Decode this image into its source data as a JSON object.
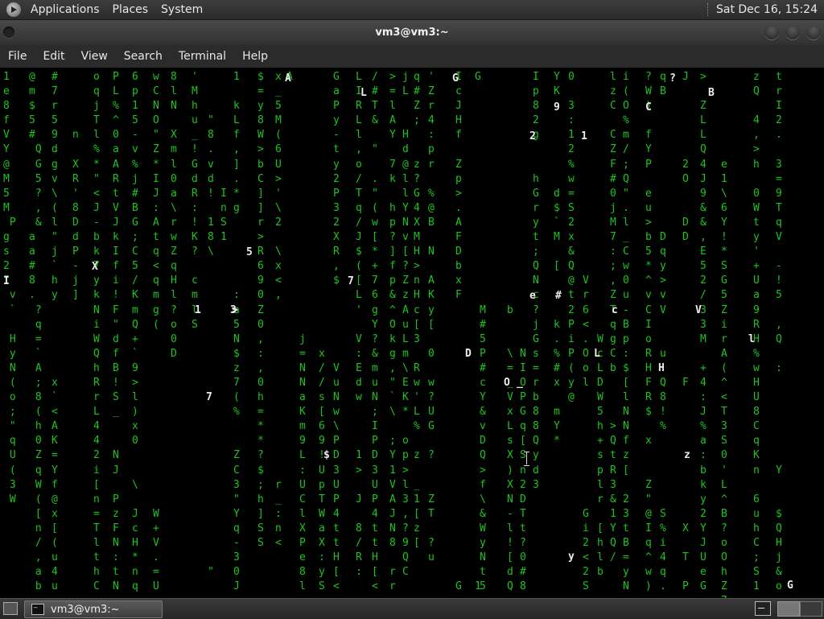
{
  "top_panel": {
    "menus": [
      "Applications",
      "Places",
      "System"
    ],
    "clock": "Sat Dec 16, 15:24"
  },
  "window": {
    "title": "vm3@vm3:~"
  },
  "menu_bar": {
    "items": [
      "File",
      "Edit",
      "View",
      "Search",
      "Terminal",
      "Help"
    ]
  },
  "terminal": {
    "rain_color": "#1ec41e",
    "highlight_color": "#ececec",
    "columns": [
      "1\ne\n8\nf\nV\nY\n@\nM\n5\nM\n P\ng\ns\n2\nI\n v\n `\n\n H\n y\n N\n (\n o\n ;\n \"\n q\n U\n (\n 3\n W",
      "@\nm\n$\n5\n#\n Q\n G\n 5\n ?\n ,\n &\na\na\n#\n8\n.\n ?\n q\n =\n `\n A\n ;\n 8\n (\n h\n 0\n Z\n q\n W\n (\n [\n n\n /\n ,\n a\n b",
      "#\n7\nr\n5\n9\nd\ng\nv\n\\\n(\nl\n\"\nj\n`\nh\ny\n\n\n\n\n\nx\n`\n<\nA\nK\n=\nY\nf\n@\nx\n[\n(\nu\n4\nu",
      "\n\n\n\nn\n\nX\nR\n'\n8\nD\nd\nP\n-\nj\n]\n",
      "o\nq\nj\nT\nl\n%\n*\n\"\n<\nJ\n-\nb\nk\n7\ny\nk\nN\ni\nW\nQ\nh\nR\nr\nL\n4\n4\n2\ni\n[\nn\n=\nT\nl\nt\nh\nC",
      "P\nL\n%\n^\n0\na\nA\nR\nt\nV\nJ\nk\nI\nf\ni\n!\nF\n\"\nd\nf\nB\n!\nS\n_\n \n \nN\nJ\n \nP\nz\nF\nN\n:\nt\nN",
      "6\np\n1\n5\n-\nv\n%\nj\n#\nB\nG\n;\nC\n5\n/\nK\nm\nQ\n+\n`\n9\n>\nl\n)\nx\n0\n \n \n\\\n \nJ\nc\nH\n*\nn\nq",
      "w\nC\nN\nO\n\"\nZ\n*\nI\nJ\n:\nA\nt\nq\n<\nq\nm\ng\n(\n\n\n\n\n\n\n\n\n\n\n\n\nW\n+\nV\n.\n=\nU",
      "8\nl\nN\n \nX\nm\nl\n0\na\n\\\nr\nw\nZ\nq\nH\nl\n?\no\n0\nD",
      "'\nM\nh\nu\n_\n!\nG\nd\nR\n:\n!\nK\n?\n \nc\nm\nl\nS",
      "\n\n\n\"\n8\n.\nv\nd\n!\n\n1\n8\n\\\n\n\n\n\n\n\n\n\n\n\n\n\n\n\n\n\n\n\n\n\n\n\"",
      "\n\n\n\n\n\n\n\nI\nn\nS\n1",
      "1\n \nk\nL\nf\n,\n]\n.\n*\ng\n \n \n \n \n \n:\na\n5\nN\n$\nz\n7\n(\n%\n \n \nZ\nC\n3\n\"\nY\nq\n-\n3\n0\nJ",
      "$\n=\ny\n8\nW\n>\nb\nC\n]\n]\nr\n>\nR\n6\n9\n0\nZ\n0\n,\n:\n,\n0\nh\n=\n*\n*\n?\n$\n;\nh\n]\nS\nS",
      "x\n_\n5\nM\n(\n6\nU\n>\n'\n\\\n2\n \n\\\nx\n<\n,\n\n\n\n\n\n\n\n\n\n\n\n\nr\n_\n:\nn\n<",
      "A",
      "\n\n\n\n\n\n\n\n\n\n\n\n\n\n\n\n\n\nj\n=\nN\nN\na\nK\nm\n9\nL\n:\nU\nC\nl\nX\nP\ne\n8\nl",
      "\n\n\n\n\n\n\n\n\n\n\n\n\n\n\n\n\n\n\nx\n/\n/\ns\n[\n6\n9\n!\nU\np\nT\nW\na\nX\n:\ny\nS",
      "G\na\nP\ny\n-\nt\ny\n2\nP\n3\n2\nX\nR\n,\n$\n\n\n\n\n\nV\nu\nN\nw\n\\\nP\nD\n3\nU\nP\n4\nt\nt\nH\n[\n<",
      "L\nI\nR\nL\nl\n,\no\n/\nT\nq\n/\nJ\n$\n(\n[\nL\n'\n\nV\n:\nE\nd\nw\n \n \n \n1\n>\n \nJ\n \n8\n/\nR\n:",
      "/\n#\nT\n&\n \n\"\n \n.\n\"\n(\nw\n[\n*\n+\n7\n6\ng\nY\n?\n&\nm\nu\nN\n;\nI\nP\nD\n3\nU\nP\n4\nt\nt\nH\n[\n<",
      ">\n=\nl\nA\nY\n \n7\nk\n \nh\np\n?\n]\nf\np\n&\n^\nO\nk\ng\n,\n\"\n`\n\\\n \n;\nY\n1\nV\nA\nJ\nN\n8\n \nr\nr",
      "j\nL\n \n \nH\nd\n@\nl\nl\nY\nN\nv\n[\n?\nZ\nz\nA\nu\nL\nm\n\\\nE\nK\n*\n \no\np\n>\nl\n3\n,\n?\n9\nQ\nC",
      "q\n#\nZ\n;\n \n \nz\n?\nG\n4\nX\nM\nH\n>\nn\nH\nc\n[\n3\n \nR\nw\n'\nL\n%\n \nz\n \n_\n1\n[\nz\n[",
      "'\nZ\nr\n4\n:\np\nr\n \n%\n@\nB\n \nN\n \nA\nK\ny\n[\n \n0\n \nw\n?\nU\nG\n \n?\n \n \nZ\nT\n \n?\nu",
      "I\nc\nJ\nH\nf\n \nZ\np\n>\n.\nA\nF\nD\nb\nx\nF\n \n\n\n\n\n\n\n\n\n\n\n\n\n\n\n\n\n\n\nG",
      "G\n\n\n\n\n\n\n\n\n\n\n\n\n\n\n\n\n\n\n\n\n\n\n\n\n\n\n\n\n\n\n\n\n\n\n1",
      "\n\n\n\n\n\n\n\n\n\n\n\n\n\n\n\nM\n#\n5\nP\n#\nc\nY\n&\nv\nD\nQ\n>\nf\n\\\n&\nW\ny\nN\nt\n5",
      "\n\n\n\n\n\n\n\n\n\n\n\n\n\n\n\nb\n \n \n\\\n=\n_\nV\nx\nL\ns\nX\n)\nX\nN\n-\nl\n!\n[\nd\nQ",
      "\n\n\n\n\n\n\n\n\n\n\n\n\n\n\n\n\n\n\nN\nI\nO\nP\nG\nq\n[\nS\nn\n2\nD\nT\nt\n?\n0\n#\n8",
      "I\np\n8\n2\ng\n \n \nh\nG\nr\ny\nt\n;\nQ\nN\nc\n?\nj\nG\ns\n=\nr\nb\n8\n8\nQ\ny\nd\n3",
      "Y\nK\n \n \n \n \n \n \nd\n$\n`\nM\n \n[\n \n \n \nk\n.\n%\n#\nx\n \nm\nY\n*",
      "0\n \n3\n:\n1\n2\n%\nw\n=\nS\n2\nx\n&\nQ\n@\nt\n2\nP\ni\nP\n(\ny\n@",
      "\n\n\n\n\n\n\n\n\n\n\n\n\n\nV\nr\n6\n<\n.\nO\no\nl\n\n\n\n\n\n\n\n\nG\ni\n2\n<\n2\nS",
      "\n\n\n\n\n\n\n\n\n\n\n\n\n\n\n\n\n\nW\nc\nL\nD\nW\n5\nh\n+\ns\np\nl\nr\n \n[\nh\nl\nb",
      "l\nz\nC\n \nC\nZ\nF\n#\n0\nj\nM\n7\n:\n;\n,\nZ\nT\nq\ng\nC\nb\n \n \n \n>\nQ\nt\nR\n3\n&\n1\nY\nQ\n/",
      "i\n(\nO\n%\nm\n/\n;\nQ\n\"\n.\nl\n_\nC\nw\n0\nu\n-\nB\np\n:\n$\n[\nl\nN\nN\nf\nz\n[\n \n2\n3\nt\nB\n=\ny\nN",
      "?\nW\n)\n \nf\nY\nP\n \ne\nu\n>\nb\n5\n*\n^\nv\nC\nI\no\nR\nH\nF\nR\n$\n \nx\n \n \nZ\n\"\n@\nI\nq\n^\nw\n)",
      "q\nB\n \n \n \n \n \n \n \n \n \nD\nq\ny\n>\nv\nV\n \n \nu\n \nQ\n8\n!\n%\n \n \n \n \n \nS\n%\ni\n4\nq\n.",
      "J\n \n \n \n \n \n2\nO\n \n \nD\nD\n \n \n \n \n \n \n \n \n \nF\n \n \n \n \n \n \n \n \n \nX\n \nT\n \nP\n \n",
      ">\n \nZ\nL\nL\nQ\n4\nJ\n9\n&\n&\n,\nE\n5\n2\n/\n3\n3\nM\n \n+\n4\n:\nJ\n%\na\n:\nb\nk\ny\n2\nY\nJ\nU\ne\nG",
      "\n\n\n\n\n\ne\n1\n\\\n6\nY\n!\n*\nS\nG\n5\nZ\ni\nr\nA\n(\n^\n<\nT\n3\nS\n0\n'\nL\n^\nB\n?\no\nO\nh\nZ\n7",
      "z\nQ\n \n4\n,\n>\nh\n \n0\nW\nt\ny\n'\n+\nU\na\n9\nR\nH\n%\nw\nH\nU\n8\nC\nq\nK\nn\n \n6\nu\nh\nC\n;\nS\n1",
      "t\nr\nI\n2\n.\n \n3\n=\n9\nT\nq\nV\n \n-\n!\n5\n \n,\nQ\n \n:\n \n \n \n \n \n \nY\n \n \n$\nQ\nH\nj\n&\no"
    ],
    "highlights": [
      "A",
      "G",
      "L",
      "9",
      "2",
      "1",
      "C",
      "?",
      "B",
      "3",
      "1",
      ">",
      "5",
      "D",
      "I",
      "X",
      "7",
      "$",
      "_",
      "e",
      "#",
      "c",
      "V",
      "l",
      "L",
      "H",
      "z",
      "O",
      "y",
      "G",
      "7"
    ]
  },
  "taskbar": {
    "task_label": "vm3@vm3:~"
  }
}
